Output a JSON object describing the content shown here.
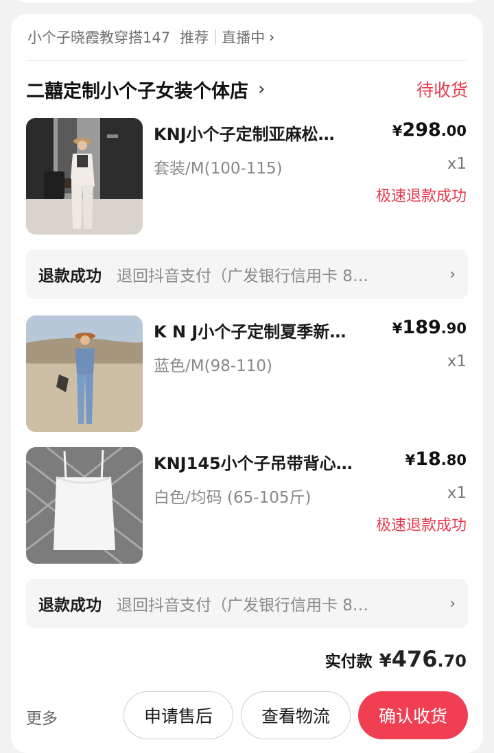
{
  "source": {
    "account": "小个子晓霞教穿搭147",
    "recommend": "推荐",
    "live": "直播中"
  },
  "shop": {
    "name": "二囍定制小个子女装个体店",
    "status": "待收货"
  },
  "items": [
    {
      "title": "KNJ小个子定制亚麻松…",
      "price_int": "298",
      "price_dec": ".00",
      "spec": "套装/M(100-115)",
      "qty": "x1",
      "badge": "极速退款成功"
    },
    {
      "title": "K N J小个子定制夏季新…",
      "price_int": "189",
      "price_dec": ".90",
      "spec": "蓝色/M(98-110)",
      "qty": "x1",
      "badge": ""
    },
    {
      "title": "KNJ145小个子吊带背心…",
      "price_int": "18",
      "price_dec": ".80",
      "spec": "白色/均码 (65-105斤)",
      "qty": "x1",
      "badge": "极速退款成功"
    }
  ],
  "currency": "¥",
  "refunds": [
    {
      "label": "退款成功",
      "detail": "退回抖音支付（广发银行信用卡 8…"
    },
    {
      "label": "退款成功",
      "detail": "退回抖音支付（广发银行信用卡 8…"
    }
  ],
  "total": {
    "label": "实付款",
    "currency": "¥",
    "int": "476",
    "dec": ".70"
  },
  "actions": {
    "more": "更多",
    "after_sales": "申请售后",
    "logistics": "查看物流",
    "confirm": "确认收货"
  },
  "colors": {
    "accent": "#f03e52",
    "status_red": "#e8394b"
  },
  "icons": {
    "chevron": "chevron-right-icon"
  }
}
